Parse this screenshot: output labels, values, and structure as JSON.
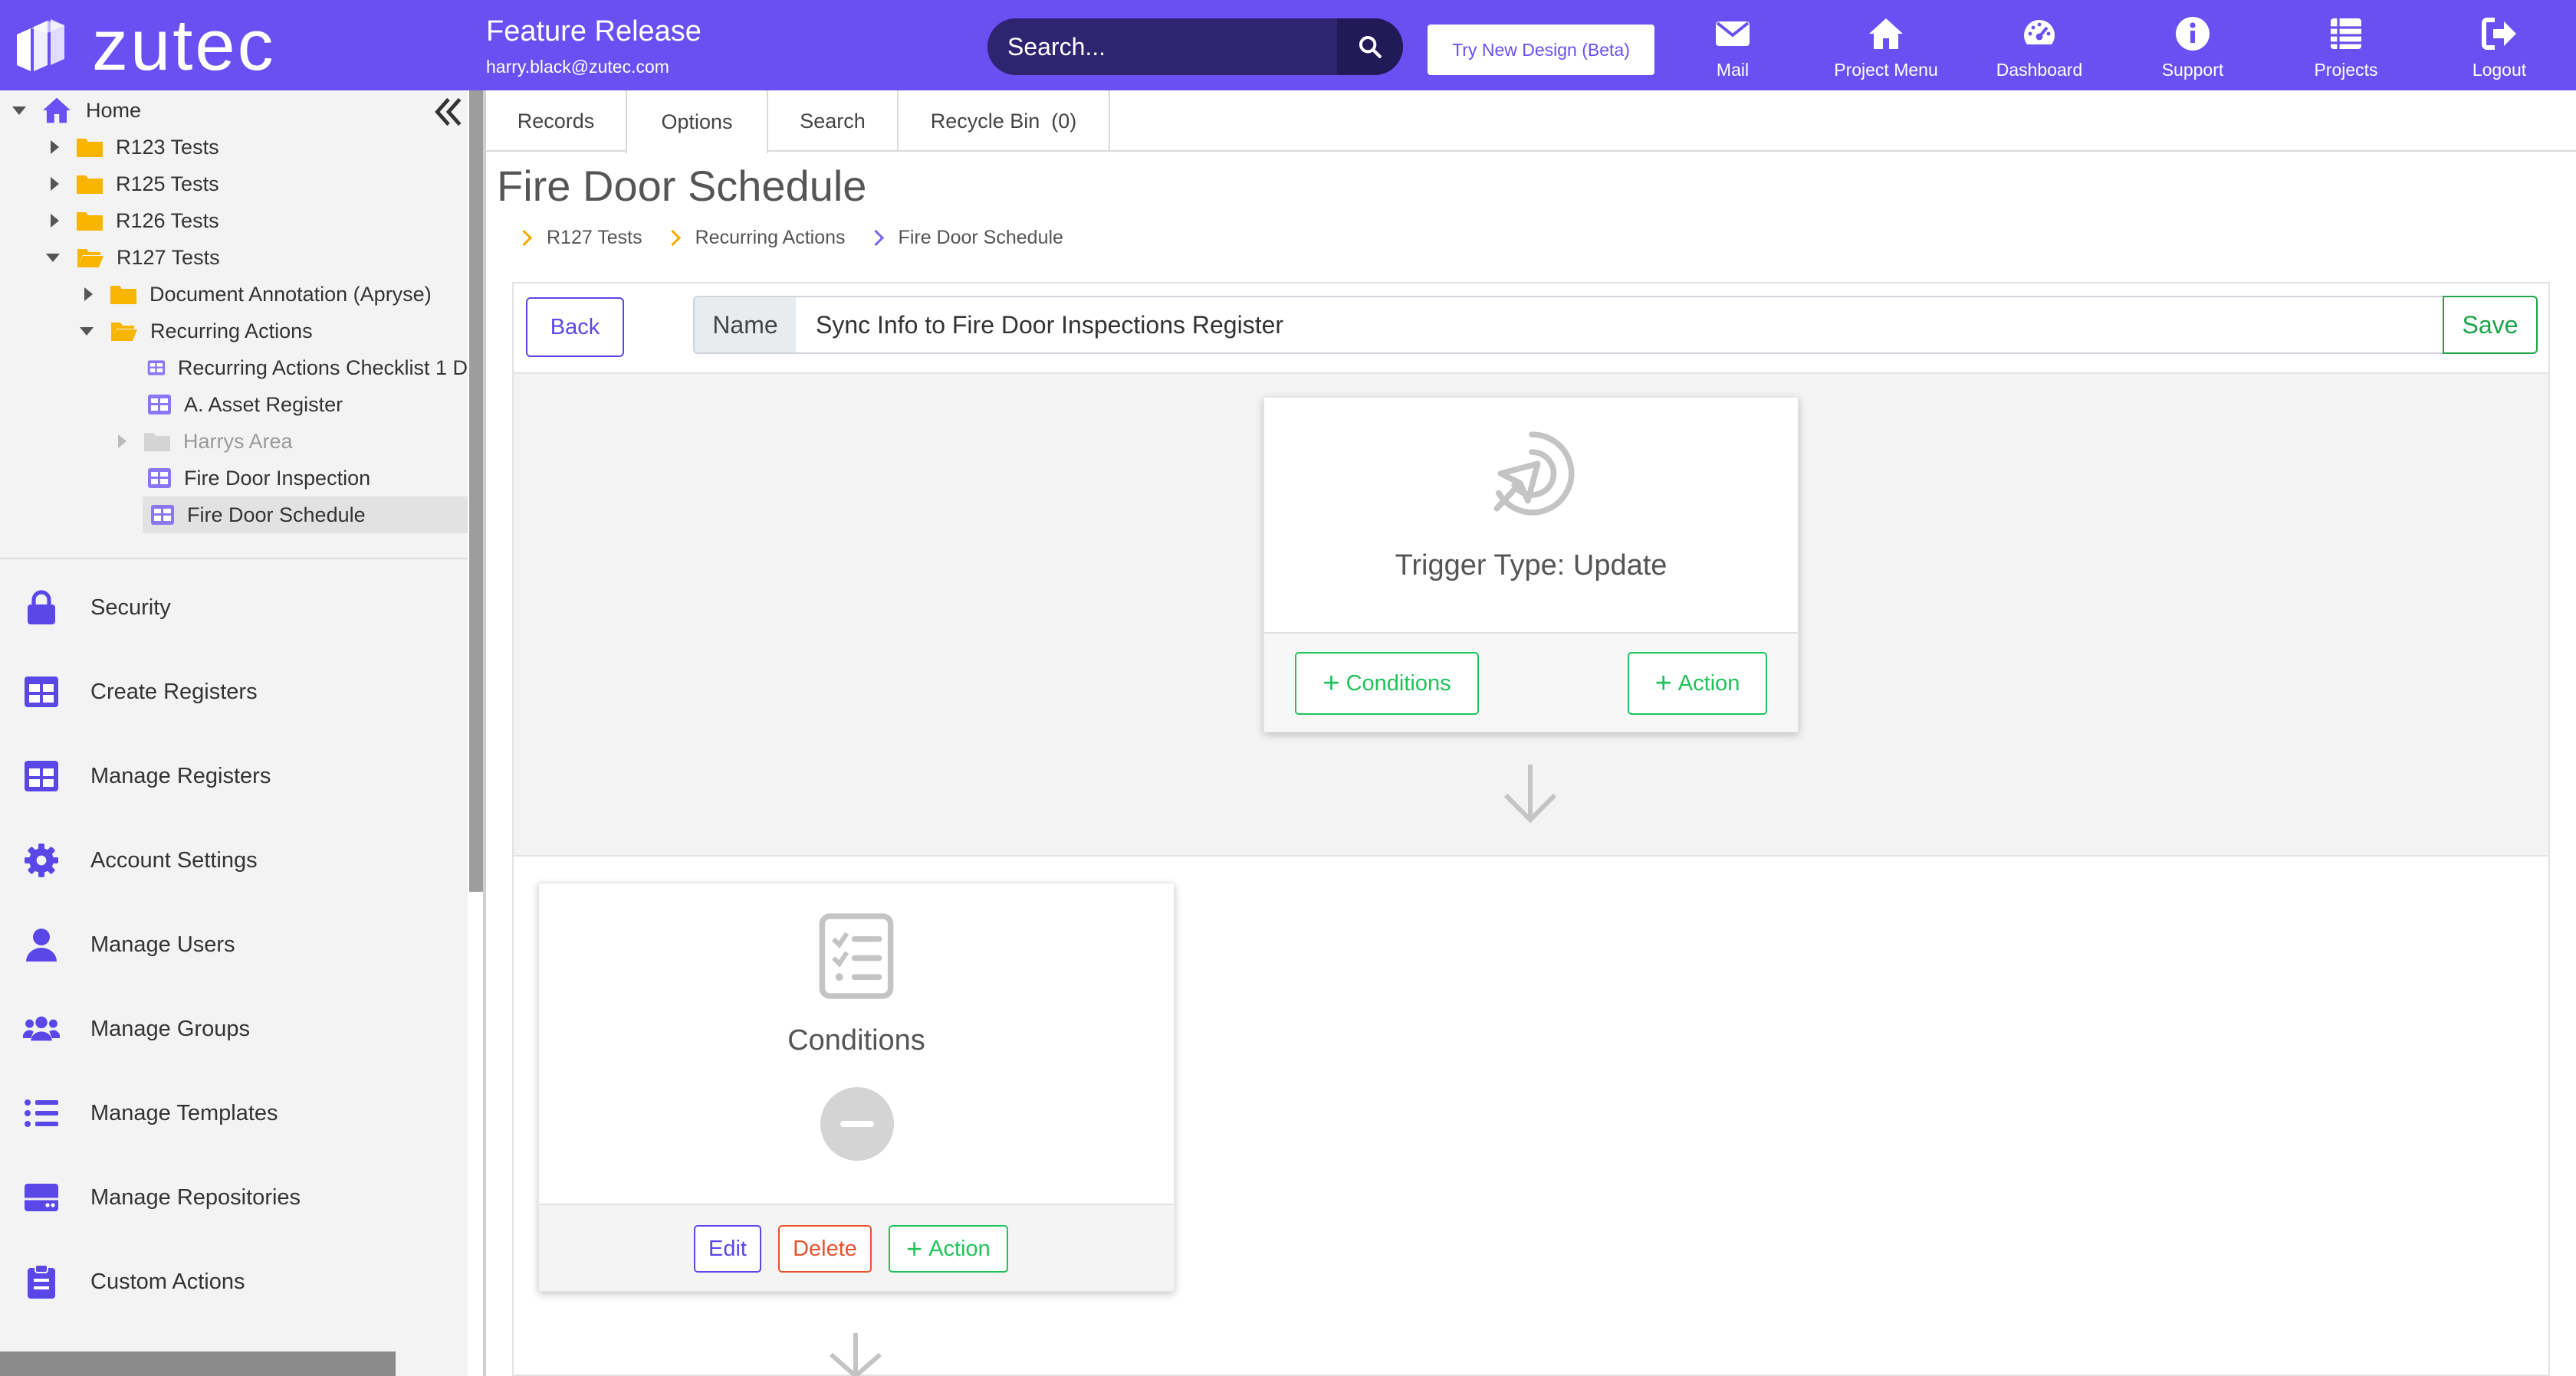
{
  "header": {
    "brand": "zutec",
    "project_name": "Feature Release",
    "user_email": "harry.black@zutec.com",
    "search_placeholder": "Search...",
    "beta_button": "Try New Design (Beta)",
    "nav": [
      {
        "label": "Mail",
        "icon": "mail-icon"
      },
      {
        "label": "Project Menu",
        "icon": "home-icon"
      },
      {
        "label": "Dashboard",
        "icon": "dashboard-icon"
      },
      {
        "label": "Support",
        "icon": "info-icon"
      },
      {
        "label": "Projects",
        "icon": "list-icon"
      },
      {
        "label": "Logout",
        "icon": "logout-icon"
      }
    ]
  },
  "tree": {
    "home": "Home",
    "items": [
      {
        "label": "R123 Tests",
        "type": "folder",
        "state": "collapsed"
      },
      {
        "label": "R125 Tests",
        "type": "folder",
        "state": "collapsed"
      },
      {
        "label": "R126 Tests",
        "type": "folder",
        "state": "collapsed"
      },
      {
        "label": "R127 Tests",
        "type": "folder",
        "state": "expanded"
      },
      {
        "label": "Document Annotation (Apryse)",
        "type": "folder",
        "state": "collapsed"
      },
      {
        "label": "Recurring Actions",
        "type": "folder",
        "state": "expanded"
      },
      {
        "label": "Recurring Actions Checklist 1 D",
        "type": "register"
      },
      {
        "label": "A. Asset Register",
        "type": "register"
      },
      {
        "label": "Harrys Area",
        "type": "folder",
        "state": "collapsed",
        "muted": true
      },
      {
        "label": "Fire Door Inspection",
        "type": "register"
      },
      {
        "label": "Fire Door Schedule",
        "type": "register",
        "selected": true
      }
    ]
  },
  "menu": [
    {
      "label": "Security",
      "icon": "lock-icon"
    },
    {
      "label": "Create Registers",
      "icon": "table-icon"
    },
    {
      "label": "Manage Registers",
      "icon": "table-icon"
    },
    {
      "label": "Account Settings",
      "icon": "gear-icon"
    },
    {
      "label": "Manage Users",
      "icon": "user-icon"
    },
    {
      "label": "Manage Groups",
      "icon": "users-icon"
    },
    {
      "label": "Manage Templates",
      "icon": "list-icon"
    },
    {
      "label": "Manage Repositories",
      "icon": "drive-icon"
    },
    {
      "label": "Custom Actions",
      "icon": "clipboard-icon"
    }
  ],
  "tabs": [
    {
      "label": "Records",
      "active": false
    },
    {
      "label": "Options",
      "active": true
    },
    {
      "label": "Search",
      "active": false
    },
    {
      "label": "Recycle Bin  (0)",
      "active": false
    }
  ],
  "page": {
    "title": "Fire Door Schedule",
    "breadcrumb": [
      "R127 Tests",
      "Recurring Actions",
      "Fire Door Schedule"
    ]
  },
  "editor": {
    "back": "Back",
    "name_label": "Name",
    "name_value": "Sync Info to Fire Door Inspections Register",
    "save": "Save",
    "trigger": {
      "title": "Trigger Type: Update",
      "conditions_button": "Conditions",
      "action_button": "Action"
    },
    "conditions": {
      "title": "Conditions",
      "edit": "Edit",
      "delete": "Delete",
      "action": "Action"
    }
  },
  "colors": {
    "brand": "#6a4ff2",
    "green": "#1ec35a",
    "red": "#e5532d",
    "folder": "#f7b500"
  }
}
